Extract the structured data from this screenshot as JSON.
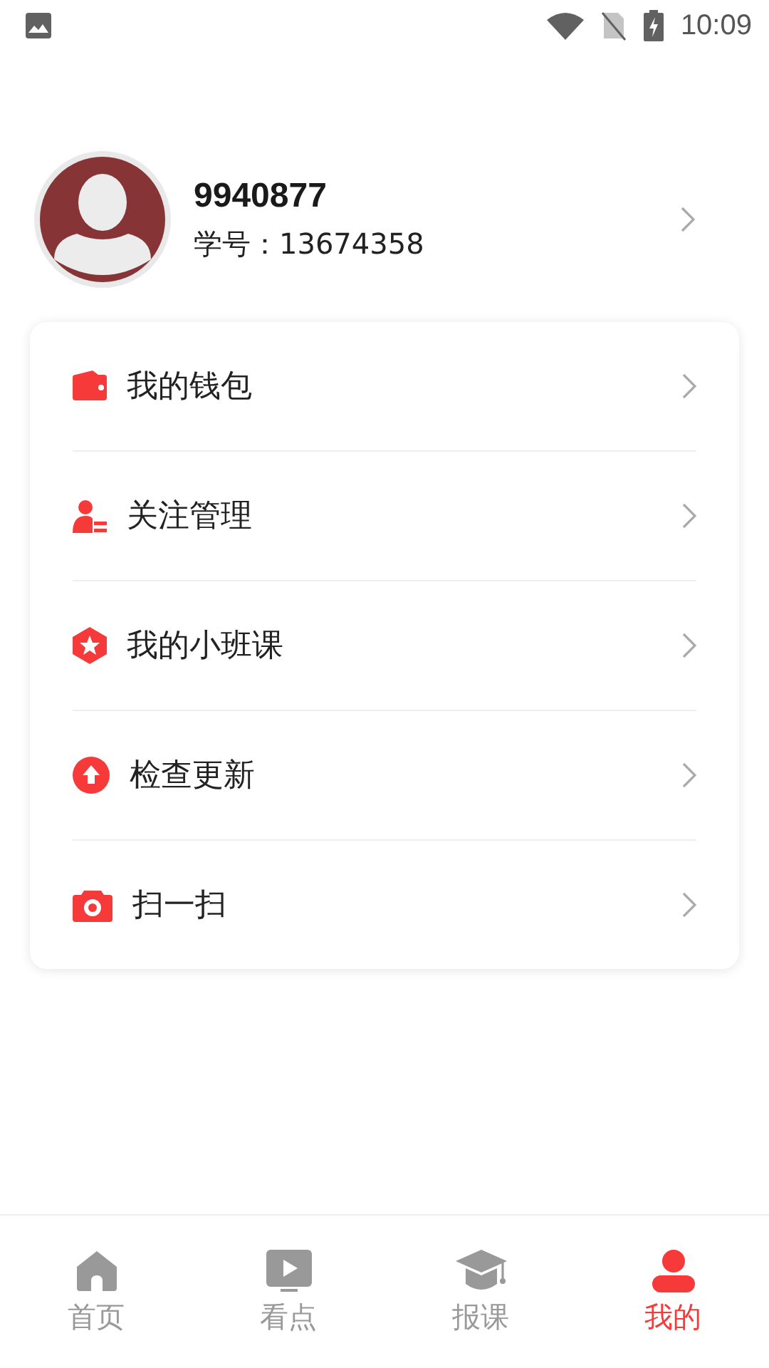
{
  "status_bar": {
    "time": "10:09"
  },
  "profile": {
    "name": "9940877",
    "student_id": "学号：13674358"
  },
  "menu": [
    {
      "kind": "wallet",
      "label": "我的钱包"
    },
    {
      "kind": "follow",
      "label": "关注管理"
    },
    {
      "kind": "class",
      "label": "我的小班课"
    },
    {
      "kind": "update",
      "label": "检查更新"
    },
    {
      "kind": "scan",
      "label": "扫一扫"
    }
  ],
  "tabs": [
    {
      "kind": "home",
      "label": "首页",
      "selected": false
    },
    {
      "kind": "video",
      "label": "看点",
      "selected": false
    },
    {
      "kind": "course",
      "label": "报课",
      "selected": false
    },
    {
      "kind": "me",
      "label": "我的",
      "selected": true
    }
  ]
}
